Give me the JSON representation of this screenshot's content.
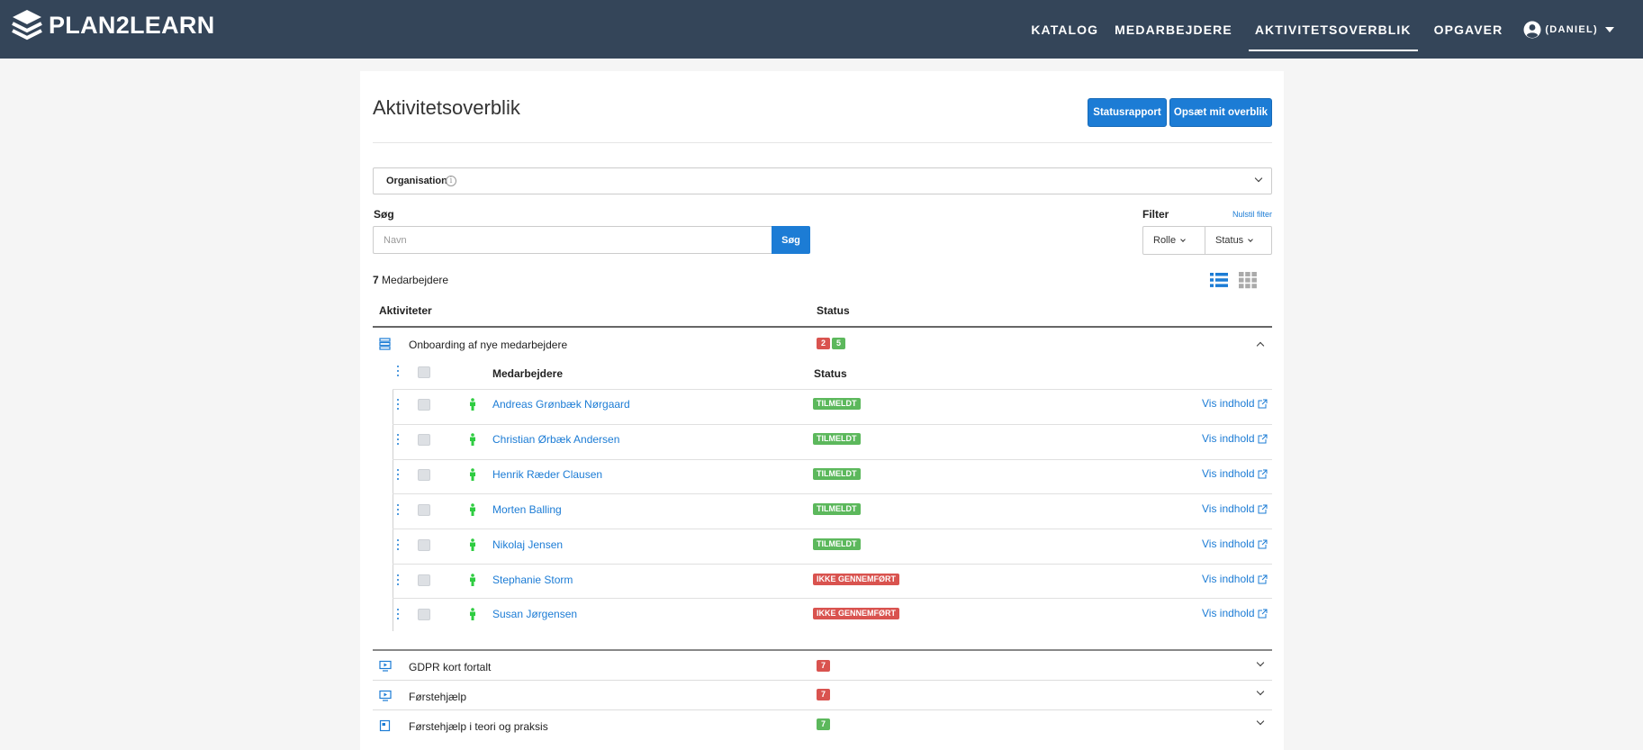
{
  "brand": {
    "name": "PLAN2LEARN"
  },
  "nav": {
    "items": [
      "KATALOG",
      "MEDARBEJDERE",
      "AKTIVITETSOVERBLIK",
      "OPGAVER"
    ],
    "active": "AKTIVITETSOVERBLIK",
    "user": "(DANIEL)"
  },
  "page": {
    "title": "Aktivitetsoverblik",
    "buttons": {
      "status_report": "Statusrapport",
      "setup": "Opsæt mit overblik"
    }
  },
  "organisation": {
    "label": "Organisation",
    "info_icon": "i"
  },
  "search": {
    "label": "Søg",
    "placeholder": "Navn",
    "button": "Søg"
  },
  "filter": {
    "label": "Filter",
    "reset": "Nulstil filter",
    "role": "Rolle",
    "status": "Status"
  },
  "count": {
    "number": "7",
    "label": "Medarbejdere"
  },
  "table": {
    "col_activities": "Aktiviteter",
    "col_status": "Status",
    "activities": [
      {
        "name": "Onboarding af nye medarbejdere",
        "icon": "course-stack-icon",
        "badges": [
          {
            "value": "2",
            "color": "red"
          },
          {
            "value": "5",
            "color": "green"
          }
        ],
        "expanded": true
      },
      {
        "name": "GDPR kort fortalt",
        "icon": "elearning-icon",
        "badges": [
          {
            "value": "7",
            "color": "red"
          }
        ],
        "expanded": false
      },
      {
        "name": "Førstehjælp",
        "icon": "elearning-icon",
        "badges": [
          {
            "value": "7",
            "color": "red"
          }
        ],
        "expanded": false
      },
      {
        "name": "Førstehjælp i teori og praksis",
        "icon": "classroom-icon",
        "badges": [
          {
            "value": "7",
            "color": "green"
          }
        ],
        "expanded": false
      }
    ]
  },
  "employees": {
    "col_name": "Medarbejdere",
    "col_status": "Status",
    "view_link": "Vis indhold",
    "rows": [
      {
        "name": "Andreas Grønbæk Nørgaard",
        "status": "TILMELDT",
        "color": "#5cb85c"
      },
      {
        "name": "Christian Ørbæk Andersen",
        "status": "TILMELDT",
        "color": "#5cb85c"
      },
      {
        "name": "Henrik Ræder Clausen",
        "status": "TILMELDT",
        "color": "#5cb85c"
      },
      {
        "name": "Morten Balling",
        "status": "TILMELDT",
        "color": "#5cb85c"
      },
      {
        "name": "Nikolaj Jensen",
        "status": "TILMELDT",
        "color": "#5cb85c"
      },
      {
        "name": "Stephanie Storm",
        "status": "IKKE GENNEMFØRT",
        "color": "#d9534f"
      },
      {
        "name": "Susan Jørgensen",
        "status": "IKKE GENNEMFØRT",
        "color": "#d9534f"
      }
    ]
  },
  "colors": {
    "topbar": "#344559",
    "accent": "#1c7cd5",
    "green": "#5cb85c",
    "red": "#d9534f",
    "person": "#2ecc40"
  }
}
